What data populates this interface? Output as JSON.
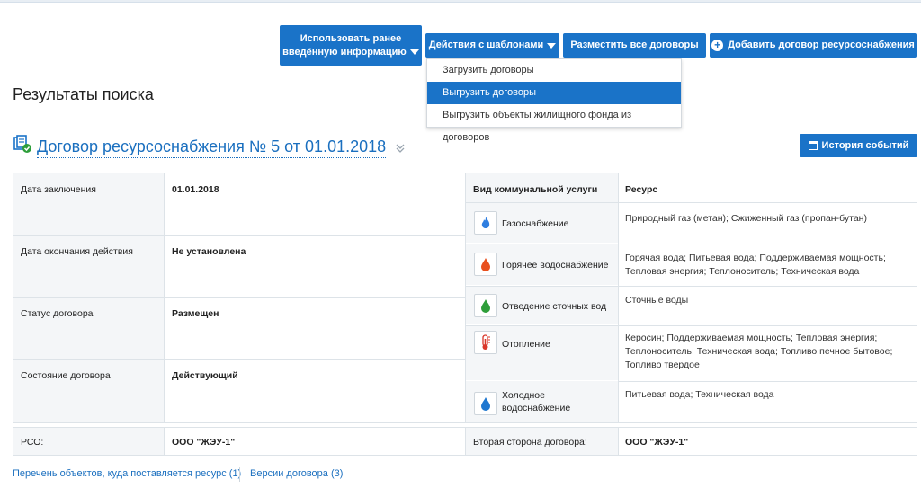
{
  "toolbar": {
    "use_prev_line1": "Использовать ранее",
    "use_prev_line2": "введённую информацию",
    "actions_label": "Действия с шаблонами",
    "place_all_label": "Разместить все договоры",
    "add_label": "Добавить договор ресурсоснабжения"
  },
  "dropdown": {
    "items": [
      {
        "label": "Загрузить договоры"
      },
      {
        "label": "Выгрузить договоры"
      },
      {
        "label": "Выгрузить объекты жилищного фонда из договоров"
      }
    ]
  },
  "results_title": "Результаты поиска",
  "contract": {
    "title": "Договор ресурсоснабжения № 5 от 01.01.2018",
    "history_label": "История событий",
    "fields": [
      {
        "label": "Дата заключения",
        "value": "01.01.2018"
      },
      {
        "label": "Дата окончания действия",
        "value": "Не установлена"
      },
      {
        "label": "Статус договора",
        "value": "Размещен"
      },
      {
        "label": "Состояние договора",
        "value": "Действующий"
      }
    ],
    "services_header": "Вид коммунальной услуги",
    "resource_header": "Ресурс",
    "services": [
      {
        "name": "Газоснабжение",
        "icon": "gas-icon",
        "resource": "Природный газ (метан); Сжиженный газ (пропан-бутан)"
      },
      {
        "name": "Горячее водоснабжение",
        "icon": "hot-water-icon",
        "resource": "Горячая вода; Питьевая вода; Поддерживаемая мощность; Тепловая энергия; Теплоноситель; Техническая вода"
      },
      {
        "name": "Отведение сточных вод",
        "icon": "sewage-icon",
        "resource": "Сточные воды"
      },
      {
        "name": "Отопление",
        "icon": "heating-icon",
        "resource": "Керосин; Поддерживаемая мощность; Тепловая энергия; Теплоноситель; Техническая вода; Топливо печное бытовое; Топливо твердое"
      },
      {
        "name_line1": "Холодное",
        "name_line2": "водоснабжение",
        "icon": "cold-water-icon",
        "resource": "Питьевая вода; Техническая вода"
      }
    ],
    "rso_label": "РСО:",
    "rso_value": "ООО \"ЖЭУ-1\"",
    "second_party_label": "Вторая сторона договора:",
    "second_party_value": "ООО \"ЖЭУ-1\""
  },
  "links": {
    "objects": "Перечень объектов, куда поставляется ресурс (1)",
    "versions": "Версии договора (3)"
  },
  "colors": {
    "primary": "#1a73c8",
    "link": "#1a6fbf",
    "gas": "#2f7ee0",
    "hot_water": "#e8501e",
    "sewage": "#2e9e3a",
    "heating": "#d9372a",
    "cold_water": "#1f77d0"
  }
}
